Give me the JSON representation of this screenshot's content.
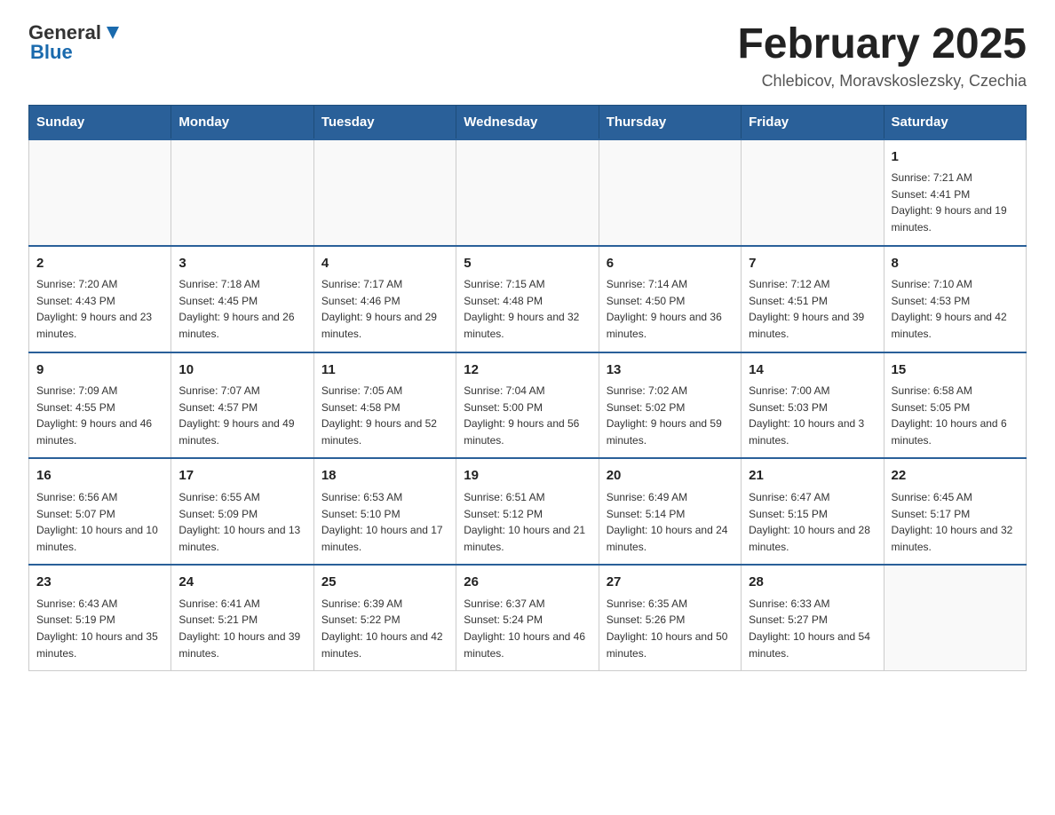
{
  "header": {
    "logo_general": "General",
    "logo_blue": "Blue",
    "month_title": "February 2025",
    "location": "Chlebicov, Moravskoslezsky, Czechia"
  },
  "weekdays": [
    "Sunday",
    "Monday",
    "Tuesday",
    "Wednesday",
    "Thursday",
    "Friday",
    "Saturday"
  ],
  "weeks": [
    [
      {
        "day": "",
        "sunrise": "",
        "sunset": "",
        "daylight": ""
      },
      {
        "day": "",
        "sunrise": "",
        "sunset": "",
        "daylight": ""
      },
      {
        "day": "",
        "sunrise": "",
        "sunset": "",
        "daylight": ""
      },
      {
        "day": "",
        "sunrise": "",
        "sunset": "",
        "daylight": ""
      },
      {
        "day": "",
        "sunrise": "",
        "sunset": "",
        "daylight": ""
      },
      {
        "day": "",
        "sunrise": "",
        "sunset": "",
        "daylight": ""
      },
      {
        "day": "1",
        "sunrise": "Sunrise: 7:21 AM",
        "sunset": "Sunset: 4:41 PM",
        "daylight": "Daylight: 9 hours and 19 minutes."
      }
    ],
    [
      {
        "day": "2",
        "sunrise": "Sunrise: 7:20 AM",
        "sunset": "Sunset: 4:43 PM",
        "daylight": "Daylight: 9 hours and 23 minutes."
      },
      {
        "day": "3",
        "sunrise": "Sunrise: 7:18 AM",
        "sunset": "Sunset: 4:45 PM",
        "daylight": "Daylight: 9 hours and 26 minutes."
      },
      {
        "day": "4",
        "sunrise": "Sunrise: 7:17 AM",
        "sunset": "Sunset: 4:46 PM",
        "daylight": "Daylight: 9 hours and 29 minutes."
      },
      {
        "day": "5",
        "sunrise": "Sunrise: 7:15 AM",
        "sunset": "Sunset: 4:48 PM",
        "daylight": "Daylight: 9 hours and 32 minutes."
      },
      {
        "day": "6",
        "sunrise": "Sunrise: 7:14 AM",
        "sunset": "Sunset: 4:50 PM",
        "daylight": "Daylight: 9 hours and 36 minutes."
      },
      {
        "day": "7",
        "sunrise": "Sunrise: 7:12 AM",
        "sunset": "Sunset: 4:51 PM",
        "daylight": "Daylight: 9 hours and 39 minutes."
      },
      {
        "day": "8",
        "sunrise": "Sunrise: 7:10 AM",
        "sunset": "Sunset: 4:53 PM",
        "daylight": "Daylight: 9 hours and 42 minutes."
      }
    ],
    [
      {
        "day": "9",
        "sunrise": "Sunrise: 7:09 AM",
        "sunset": "Sunset: 4:55 PM",
        "daylight": "Daylight: 9 hours and 46 minutes."
      },
      {
        "day": "10",
        "sunrise": "Sunrise: 7:07 AM",
        "sunset": "Sunset: 4:57 PM",
        "daylight": "Daylight: 9 hours and 49 minutes."
      },
      {
        "day": "11",
        "sunrise": "Sunrise: 7:05 AM",
        "sunset": "Sunset: 4:58 PM",
        "daylight": "Daylight: 9 hours and 52 minutes."
      },
      {
        "day": "12",
        "sunrise": "Sunrise: 7:04 AM",
        "sunset": "Sunset: 5:00 PM",
        "daylight": "Daylight: 9 hours and 56 minutes."
      },
      {
        "day": "13",
        "sunrise": "Sunrise: 7:02 AM",
        "sunset": "Sunset: 5:02 PM",
        "daylight": "Daylight: 9 hours and 59 minutes."
      },
      {
        "day": "14",
        "sunrise": "Sunrise: 7:00 AM",
        "sunset": "Sunset: 5:03 PM",
        "daylight": "Daylight: 10 hours and 3 minutes."
      },
      {
        "day": "15",
        "sunrise": "Sunrise: 6:58 AM",
        "sunset": "Sunset: 5:05 PM",
        "daylight": "Daylight: 10 hours and 6 minutes."
      }
    ],
    [
      {
        "day": "16",
        "sunrise": "Sunrise: 6:56 AM",
        "sunset": "Sunset: 5:07 PM",
        "daylight": "Daylight: 10 hours and 10 minutes."
      },
      {
        "day": "17",
        "sunrise": "Sunrise: 6:55 AM",
        "sunset": "Sunset: 5:09 PM",
        "daylight": "Daylight: 10 hours and 13 minutes."
      },
      {
        "day": "18",
        "sunrise": "Sunrise: 6:53 AM",
        "sunset": "Sunset: 5:10 PM",
        "daylight": "Daylight: 10 hours and 17 minutes."
      },
      {
        "day": "19",
        "sunrise": "Sunrise: 6:51 AM",
        "sunset": "Sunset: 5:12 PM",
        "daylight": "Daylight: 10 hours and 21 minutes."
      },
      {
        "day": "20",
        "sunrise": "Sunrise: 6:49 AM",
        "sunset": "Sunset: 5:14 PM",
        "daylight": "Daylight: 10 hours and 24 minutes."
      },
      {
        "day": "21",
        "sunrise": "Sunrise: 6:47 AM",
        "sunset": "Sunset: 5:15 PM",
        "daylight": "Daylight: 10 hours and 28 minutes."
      },
      {
        "day": "22",
        "sunrise": "Sunrise: 6:45 AM",
        "sunset": "Sunset: 5:17 PM",
        "daylight": "Daylight: 10 hours and 32 minutes."
      }
    ],
    [
      {
        "day": "23",
        "sunrise": "Sunrise: 6:43 AM",
        "sunset": "Sunset: 5:19 PM",
        "daylight": "Daylight: 10 hours and 35 minutes."
      },
      {
        "day": "24",
        "sunrise": "Sunrise: 6:41 AM",
        "sunset": "Sunset: 5:21 PM",
        "daylight": "Daylight: 10 hours and 39 minutes."
      },
      {
        "day": "25",
        "sunrise": "Sunrise: 6:39 AM",
        "sunset": "Sunset: 5:22 PM",
        "daylight": "Daylight: 10 hours and 42 minutes."
      },
      {
        "day": "26",
        "sunrise": "Sunrise: 6:37 AM",
        "sunset": "Sunset: 5:24 PM",
        "daylight": "Daylight: 10 hours and 46 minutes."
      },
      {
        "day": "27",
        "sunrise": "Sunrise: 6:35 AM",
        "sunset": "Sunset: 5:26 PM",
        "daylight": "Daylight: 10 hours and 50 minutes."
      },
      {
        "day": "28",
        "sunrise": "Sunrise: 6:33 AM",
        "sunset": "Sunset: 5:27 PM",
        "daylight": "Daylight: 10 hours and 54 minutes."
      },
      {
        "day": "",
        "sunrise": "",
        "sunset": "",
        "daylight": ""
      }
    ]
  ]
}
